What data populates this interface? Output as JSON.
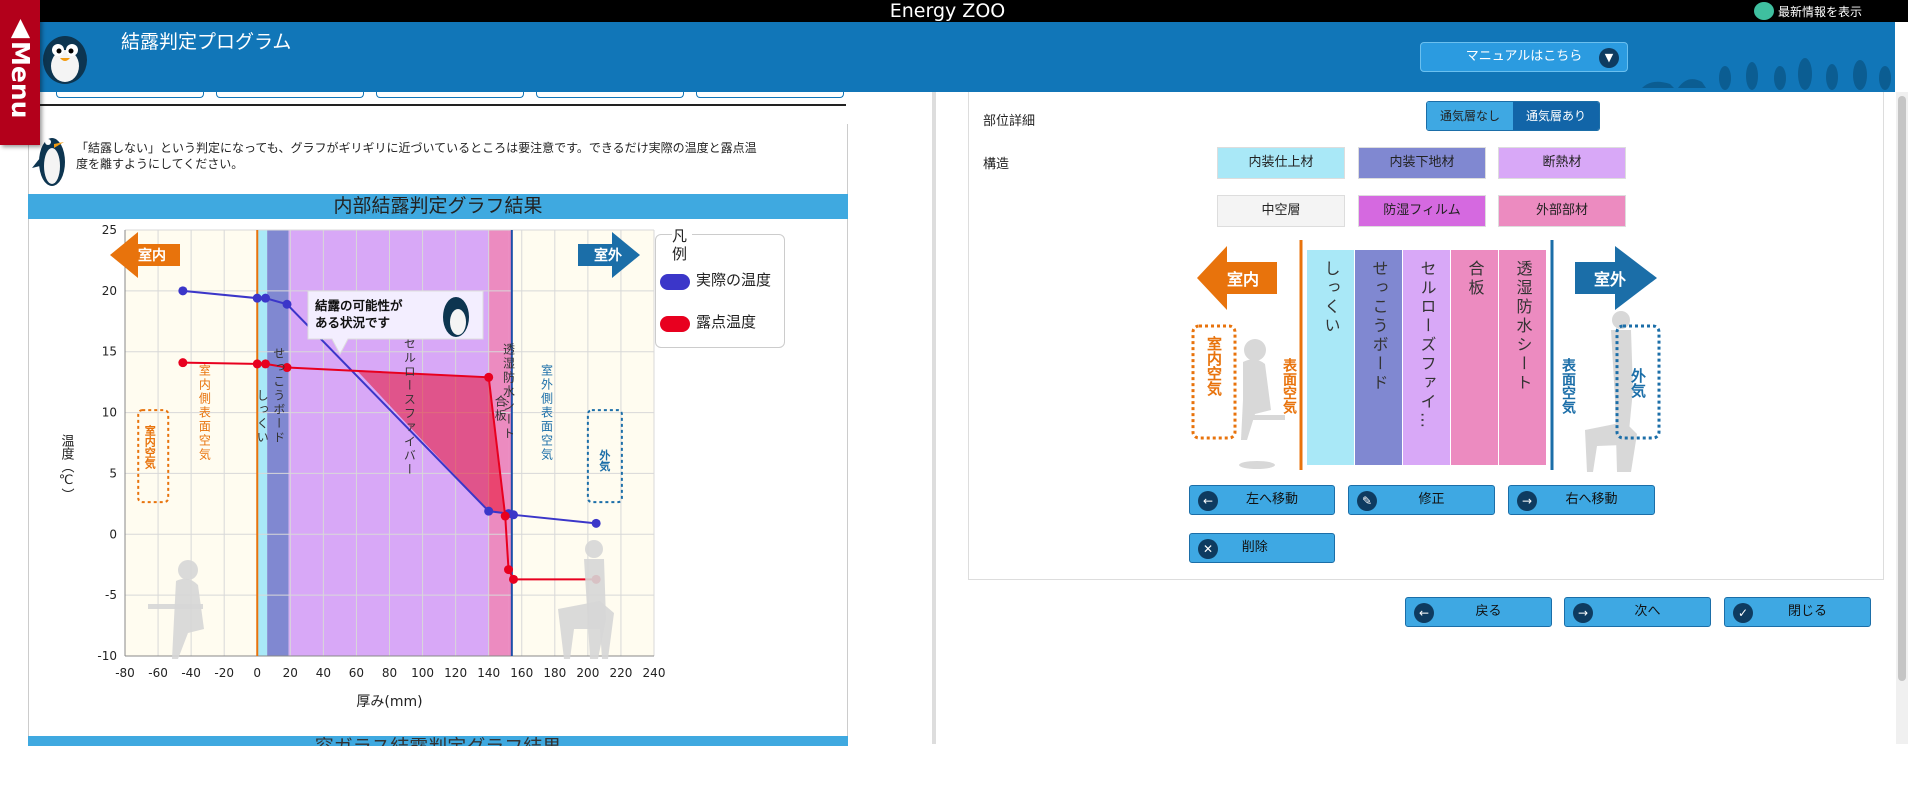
{
  "window": {
    "app_title": "Energy ZOO",
    "news_label": "最新情報を表示"
  },
  "header": {
    "program_title": "結露判定プログラム",
    "manual_button": "マニュアルはこちら"
  },
  "menu": {
    "label": "▲Menu"
  },
  "notice": {
    "text": "「結露しない」という判定になっても、グラフがギリギリに近づいているところは要注意です。できるだけ実際の温度と露点温度を離すようにしてください。"
  },
  "section": {
    "title": "内部結露判定グラフ結果",
    "next_title": "窓ガラス結露判定グラフ結果"
  },
  "chart_data": {
    "type": "line",
    "xlabel": "厚み(mm)",
    "ylabel": "温度（℃）",
    "xlim": [
      -80,
      240
    ],
    "ylim": [
      -10,
      25
    ],
    "x_ticks": [
      -80,
      -60,
      -40,
      -20,
      0,
      20,
      40,
      60,
      80,
      100,
      120,
      140,
      160,
      180,
      200,
      220,
      240
    ],
    "y_ticks": [
      -10,
      -5,
      0,
      5,
      10,
      15,
      20,
      25
    ],
    "legend_title": "凡例",
    "legend_position": "top-right",
    "grid": true,
    "series": [
      {
        "name": "実際の温度",
        "color": "#3b36c9",
        "x": [
          -45,
          0,
          5,
          18,
          140,
          152,
          155,
          205
        ],
        "y": [
          20.0,
          19.4,
          19.4,
          18.9,
          1.9,
          1.7,
          1.6,
          0.9
        ]
      },
      {
        "name": "露点温度",
        "color": "#e8001f",
        "x": [
          -45,
          0,
          5,
          18,
          140,
          150,
          152,
          155,
          205
        ],
        "y": [
          14.1,
          14.0,
          14.0,
          13.7,
          12.9,
          1.5,
          -2.9,
          -3.7,
          -3.7
        ]
      }
    ],
    "layers": [
      {
        "label": "しっくい",
        "x0": 0,
        "x1": 6,
        "color": "#a9e8f7"
      },
      {
        "label": "せっこうボード",
        "x0": 6,
        "x1": 19,
        "color": "#8088d1"
      },
      {
        "label": "セルロースファイバー",
        "x0": 19,
        "x1": 140,
        "color": "#d8a8f7"
      },
      {
        "label": "合板",
        "x0": 140,
        "x1": 152,
        "color": "#ec8bc0"
      },
      {
        "label": "透湿防水シート",
        "x0": 152,
        "x1": 154,
        "color": "#ec8bc0"
      }
    ],
    "region_labels": {
      "indoor": "室内",
      "outdoor": "室外",
      "indoor_air": "室内空気",
      "indoor_surface_air": "室内側表面空気",
      "outdoor_surface_air": "室外側表面空気",
      "outdoor_air": "外気"
    },
    "callout": "結露の可能性がある状況です"
  },
  "right": {
    "detail_label": "部位詳細",
    "structure_label": "構造",
    "seg_options": [
      "通気層なし",
      "通気層あり"
    ],
    "seg_selected": "通気層あり",
    "materials": [
      {
        "label": "内装仕上材",
        "color": "#a9e8f7"
      },
      {
        "label": "内装下地材",
        "color": "#8088d1"
      },
      {
        "label": "断熱材",
        "color": "#d8a8f7"
      },
      {
        "label": "中空層",
        "color": "#f4f4f4"
      },
      {
        "label": "防湿フィルム",
        "color": "#d569e0"
      },
      {
        "label": "外部部材",
        "color": "#ec8bc0"
      }
    ],
    "wall_layers": [
      {
        "label": "しっくい",
        "color": "#a9e8f7"
      },
      {
        "label": "せっこうボード",
        "color": "#8088d1"
      },
      {
        "label": "セルローズファイ…",
        "color": "#d8a8f7"
      },
      {
        "label": "合板",
        "color": "#ec8bc0"
      },
      {
        "label": "透湿防水シート",
        "color": "#ec8bc0"
      }
    ],
    "wall_indoor": "室内",
    "wall_outdoor": "室外",
    "wall_indoor_air": "室内空気",
    "wall_indoor_surface": "表面空気",
    "wall_outdoor_surface": "表面空気",
    "wall_outdoor_air": "外気",
    "buttons": {
      "move_left": "左へ移動",
      "edit": "修正",
      "move_right": "右へ移動",
      "delete": "削除",
      "back": "戻る",
      "next": "次へ",
      "close": "閉じる"
    }
  }
}
